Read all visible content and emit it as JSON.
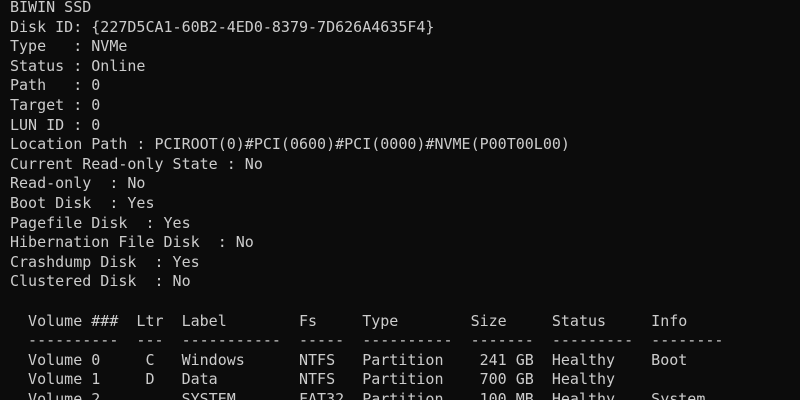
{
  "window": {
    "type": "console",
    "colors": {
      "background": "#0c0c0c",
      "text": "#cccccc"
    }
  },
  "output_lines": [
    "BIWIN SSD",
    "Disk ID: {227D5CA1-60B2-4ED0-8379-7D626A4635F4}",
    "Type   : NVMe",
    "Status : Online",
    "Path   : 0",
    "Target : 0",
    "LUN ID : 0",
    "Location Path : PCIROOT(0)#PCI(0600)#PCI(0000)#NVME(P00T00L00)",
    "Current Read-only State : No",
    "Read-only  : No",
    "Boot Disk  : Yes",
    "Pagefile Disk  : Yes",
    "Hibernation File Disk  : No",
    "Crashdump Disk  : Yes",
    "Clustered Disk  : No"
  ],
  "volume_table": {
    "header": "  Volume ###  Ltr  Label        Fs     Type        Size     Status     Info",
    "separator": "  ----------  ---  -----------  -----  ----------  -------  ---------  --------",
    "rows": [
      "  Volume 0     C   Windows      NTFS   Partition    241 GB  Healthy    Boot",
      "  Volume 1     D   Data         NTFS   Partition    700 GB  Healthy",
      "  Volume 2         SYSTEM       FAT32  Partition    100 MB  Healthy    System"
    ]
  }
}
